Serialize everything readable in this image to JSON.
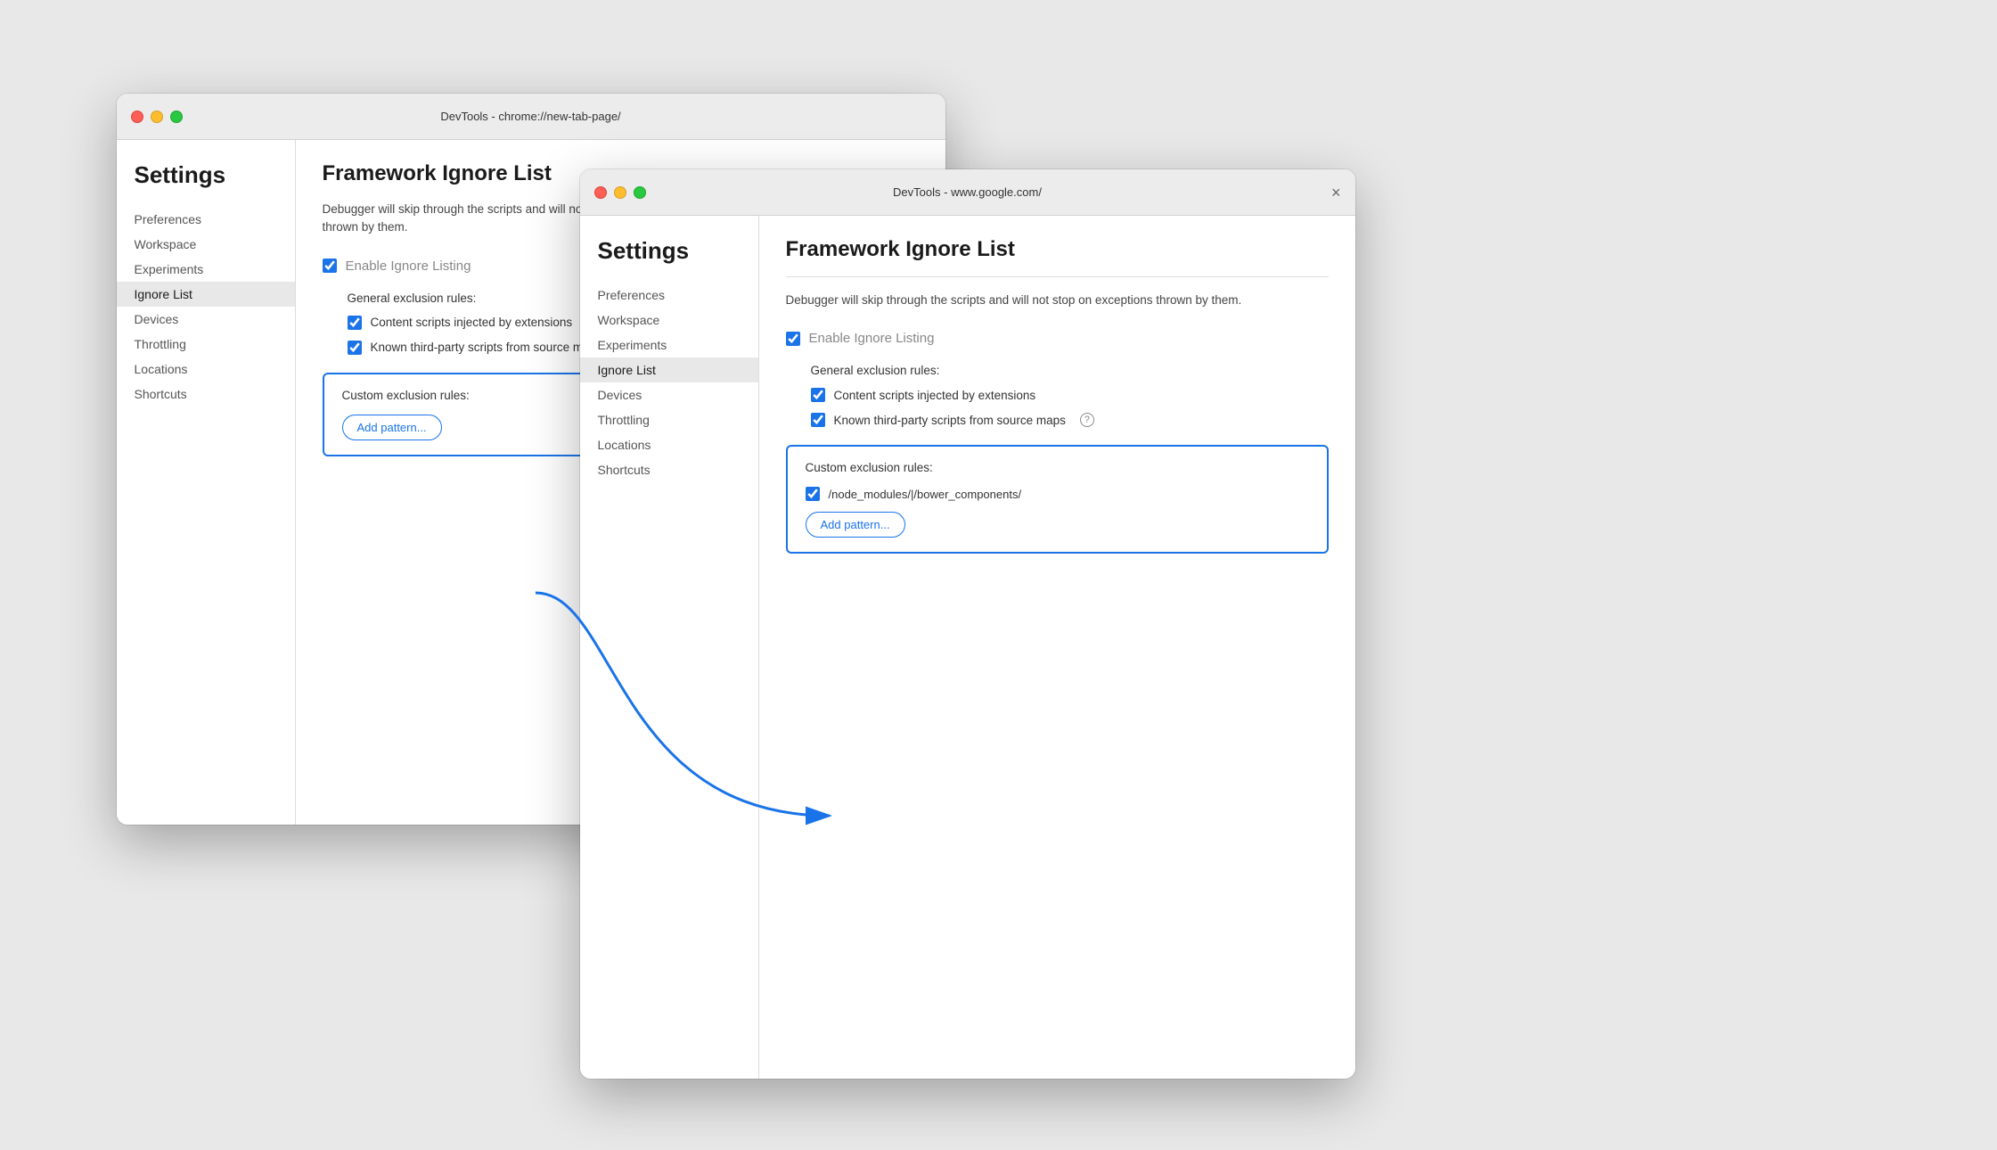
{
  "window1": {
    "titleBar": {
      "title": "DevTools - chrome://new-tab-page/",
      "closeLabel": "×"
    },
    "sidebar": {
      "title": "Settings",
      "navItems": [
        {
          "label": "Preferences",
          "active": false
        },
        {
          "label": "Workspace",
          "active": false
        },
        {
          "label": "Experiments",
          "active": false
        },
        {
          "label": "Ignore List",
          "active": true
        },
        {
          "label": "Devices",
          "active": false
        },
        {
          "label": "Throttling",
          "active": false
        },
        {
          "label": "Locations",
          "active": false
        },
        {
          "label": "Shortcuts",
          "active": false
        }
      ]
    },
    "main": {
      "sectionTitle": "Framework Ignore List",
      "description": "Debugger will skip through the scripts and will not stop on exceptions thrown by them.",
      "enableCheckbox": {
        "label": "Enable Ignore Listing",
        "checked": true
      },
      "generalRulesTitle": "General exclusion rules:",
      "generalRules": [
        {
          "label": "Content scripts injected by extensions",
          "checked": true
        },
        {
          "label": "Known third-party scripts from source maps",
          "checked": true
        }
      ],
      "customRules": {
        "title": "Custom exclusion rules:",
        "addPatternLabel": "Add pattern..."
      }
    }
  },
  "window2": {
    "titleBar": {
      "title": "DevTools - www.google.com/",
      "closeLabel": "×"
    },
    "sidebar": {
      "title": "Settings",
      "navItems": [
        {
          "label": "Preferences",
          "active": false
        },
        {
          "label": "Workspace",
          "active": false
        },
        {
          "label": "Experiments",
          "active": false
        },
        {
          "label": "Ignore List",
          "active": true
        },
        {
          "label": "Devices",
          "active": false
        },
        {
          "label": "Throttling",
          "active": false
        },
        {
          "label": "Locations",
          "active": false
        },
        {
          "label": "Shortcuts",
          "active": false
        }
      ]
    },
    "main": {
      "sectionTitle": "Framework Ignore List",
      "description": "Debugger will skip through the scripts and will not stop on exceptions thrown by them.",
      "enableCheckbox": {
        "label": "Enable Ignore Listing",
        "checked": true
      },
      "generalRulesTitle": "General exclusion rules:",
      "generalRules": [
        {
          "label": "Content scripts injected by extensions",
          "checked": true
        },
        {
          "label": "Known third-party scripts from source maps",
          "checked": true
        }
      ],
      "customRules": {
        "title": "Custom exclusion rules:",
        "patterns": [
          {
            "label": "/node_modules/|/bower_components/",
            "checked": true
          }
        ],
        "addPatternLabel": "Add pattern..."
      }
    }
  },
  "colors": {
    "blue": "#1a73e8",
    "activeNavBg": "#e8e8e8"
  }
}
